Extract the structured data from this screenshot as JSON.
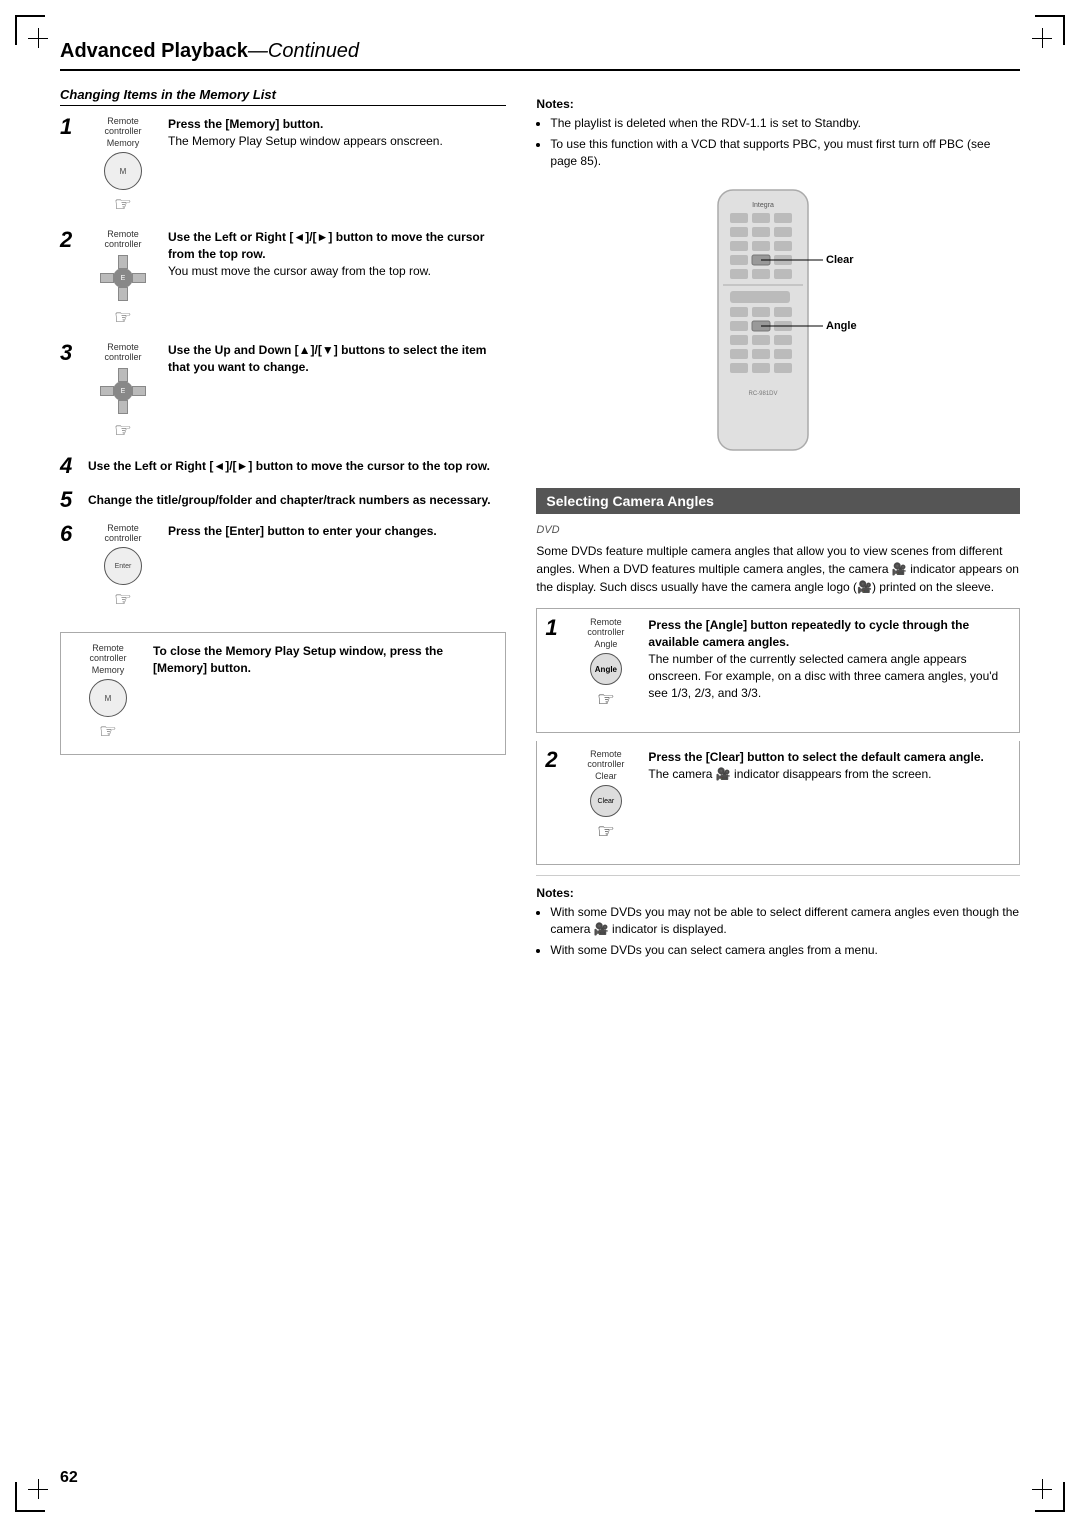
{
  "page": {
    "number": "62",
    "title": "Advanced Playback",
    "title_continued": "—Continued"
  },
  "left_section": {
    "title": "Changing Items in the Memory List",
    "steps": [
      {
        "number": "1",
        "has_icon": true,
        "icon_label": "Remote controller",
        "icon_sub": "Memory",
        "instruction_bold": "Press the [Memory] button.",
        "instruction_normal": "The Memory Play Setup window appears onscreen."
      },
      {
        "number": "2",
        "has_icon": true,
        "icon_label": "Remote controller",
        "icon_sub": "",
        "instruction_bold": "Use the Left or Right [◄]/[►] button to move the cursor from the top row.",
        "instruction_normal": "You must move the cursor away from the top row."
      },
      {
        "number": "3",
        "has_icon": true,
        "icon_label": "Remote controller",
        "icon_sub": "",
        "instruction_bold": "Use the Up and Down [▲]/[▼] buttons to select the item that you want to change.",
        "instruction_normal": ""
      },
      {
        "number": "4",
        "has_icon": false,
        "instruction_bold": "Use the Left or Right [◄]/[►] button to move the cursor to the top row.",
        "instruction_normal": ""
      },
      {
        "number": "5",
        "has_icon": false,
        "instruction_bold": "Change the title/group/folder and chapter/track numbers as necessary.",
        "instruction_normal": ""
      },
      {
        "number": "6",
        "has_icon": true,
        "icon_label": "Remote controller",
        "icon_sub": "",
        "instruction_bold": "Press the [Enter] button to enter your changes.",
        "instruction_normal": ""
      }
    ],
    "bottom_note": {
      "icon_label": "Remote controller",
      "icon_sub": "Memory",
      "instruction_bold": "To close the Memory Play Setup window, press the [Memory] button."
    }
  },
  "right_section": {
    "notes": {
      "title": "Notes:",
      "items": [
        "The playlist is deleted when the RDV-1.1 is set to Standby.",
        "To use this function with a VCD that supports PBC, you must first turn off PBC (see page 85)."
      ]
    },
    "callouts": {
      "clear_label": "Clear",
      "angle_label": "Angle"
    },
    "camera_section": {
      "title": "Selecting Camera Angles",
      "dvd_symbol": "DVD",
      "intro": "Some DVDs feature multiple camera angles that allow you to view scenes from different angles. When a DVD features multiple camera angles, the camera ⚙ indicator appears on the display. Such discs usually have the camera angle logo (⚙) printed on the sleeve.",
      "steps": [
        {
          "number": "1",
          "icon_label": "Remote controller",
          "icon_sub": "Angle",
          "instruction_bold": "Press the [Angle] button repeatedly to cycle through the available camera angles.",
          "instruction_normal": "The number of the currently selected camera angle appears onscreen. For example, on a disc with three camera angles, you'd see 1/3, 2/3, and 3/3."
        },
        {
          "number": "2",
          "icon_label": "Remote controller",
          "icon_sub": "Clear",
          "instruction_bold": "Press the [Clear] button to select the default camera angle.",
          "instruction_normal": "The camera ⚙ indicator disappears from the screen."
        }
      ],
      "notes": {
        "title": "Notes:",
        "items": [
          "With some DVDs you may not be able to select different camera angles even though the camera ⚙ indicator is displayed.",
          "With some DVDs you can select camera angles from a menu."
        ]
      }
    }
  }
}
